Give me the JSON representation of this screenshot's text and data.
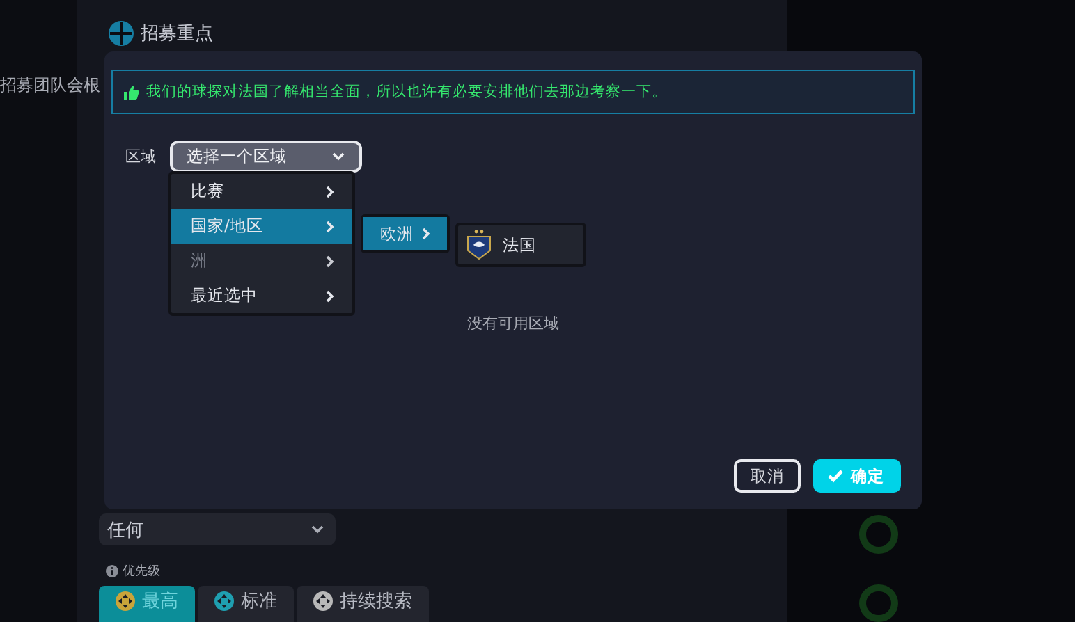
{
  "background": {
    "section_title": "招募重点",
    "intro_text": "招募团队会根",
    "filter_select": {
      "value": "任何"
    },
    "priority": {
      "label": "优先级",
      "options": [
        {
          "label": "最高",
          "selected": true,
          "color": "#c9a43a"
        },
        {
          "label": "标准",
          "selected": false,
          "color": "#1f9fb0"
        },
        {
          "label": "持续搜索",
          "selected": false,
          "color": "#b8b8b8"
        }
      ]
    }
  },
  "dialog": {
    "banner": {
      "text": "我们的球探对法国了解相当全面，所以也许有必要安排他们去那边考察一下。"
    },
    "field": {
      "label": "区域",
      "placeholder": "选择一个区域"
    },
    "menu": [
      {
        "label": "比赛",
        "selected": false,
        "disabled": false
      },
      {
        "label": "国家/地区",
        "selected": true,
        "disabled": false
      },
      {
        "label": "洲",
        "selected": false,
        "disabled": true
      },
      {
        "label": "最近选中",
        "selected": false,
        "disabled": false
      }
    ],
    "submenu": [
      {
        "label": "欧洲",
        "selected": true
      }
    ],
    "leaf_menu": [
      {
        "label": "法国",
        "selected": false
      }
    ],
    "empty_text": "没有可用区域",
    "buttons": [
      {
        "label": "取消",
        "kind": "secondary"
      },
      {
        "label": "确定",
        "kind": "primary"
      }
    ]
  }
}
